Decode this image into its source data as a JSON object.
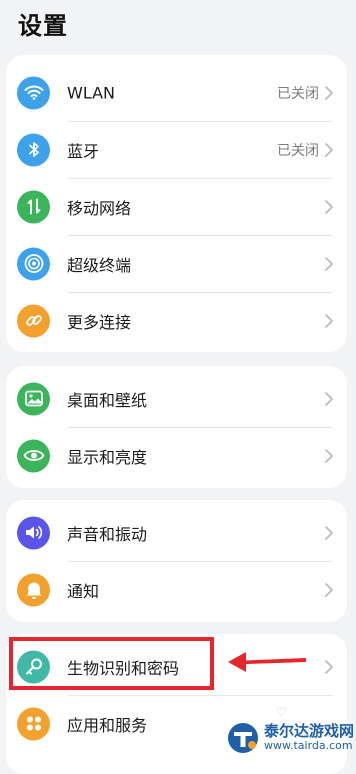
{
  "header": {
    "title": "设置"
  },
  "groups": [
    {
      "items": [
        {
          "label": "WLAN",
          "value": "已关闭",
          "icon": "wifi-icon",
          "color": "#3da2ea"
        },
        {
          "label": "蓝牙",
          "value": "已关闭",
          "icon": "bluetooth-icon",
          "color": "#3da2ea"
        },
        {
          "label": "移动网络",
          "value": "",
          "icon": "mobile-data-icon",
          "color": "#3cb55a"
        },
        {
          "label": "超级终端",
          "value": "",
          "icon": "super-device-icon",
          "color": "#3da2ea"
        },
        {
          "label": "更多连接",
          "value": "",
          "icon": "link-icon",
          "color": "#f2a12e"
        }
      ]
    },
    {
      "items": [
        {
          "label": "桌面和壁纸",
          "value": "",
          "icon": "wallpaper-icon",
          "color": "#3cb55a"
        },
        {
          "label": "显示和亮度",
          "value": "",
          "icon": "eye-icon",
          "color": "#3cb55a"
        }
      ]
    },
    {
      "items": [
        {
          "label": "声音和振动",
          "value": "",
          "icon": "speaker-icon",
          "color": "#5a54e8"
        },
        {
          "label": "通知",
          "value": "",
          "icon": "bell-icon",
          "color": "#f2a12e"
        }
      ]
    },
    {
      "items": [
        {
          "label": "生物识别和密码",
          "value": "",
          "icon": "key-icon",
          "color": "#3fb8a6"
        },
        {
          "label": "应用和服务",
          "value": "",
          "icon": "apps-icon",
          "color": "#f2a12e"
        }
      ]
    }
  ],
  "annotation": {
    "highlight_color": "#e5262c"
  },
  "watermark": {
    "name": "泰尔达游戏网",
    "url": "www.tairda.com"
  }
}
